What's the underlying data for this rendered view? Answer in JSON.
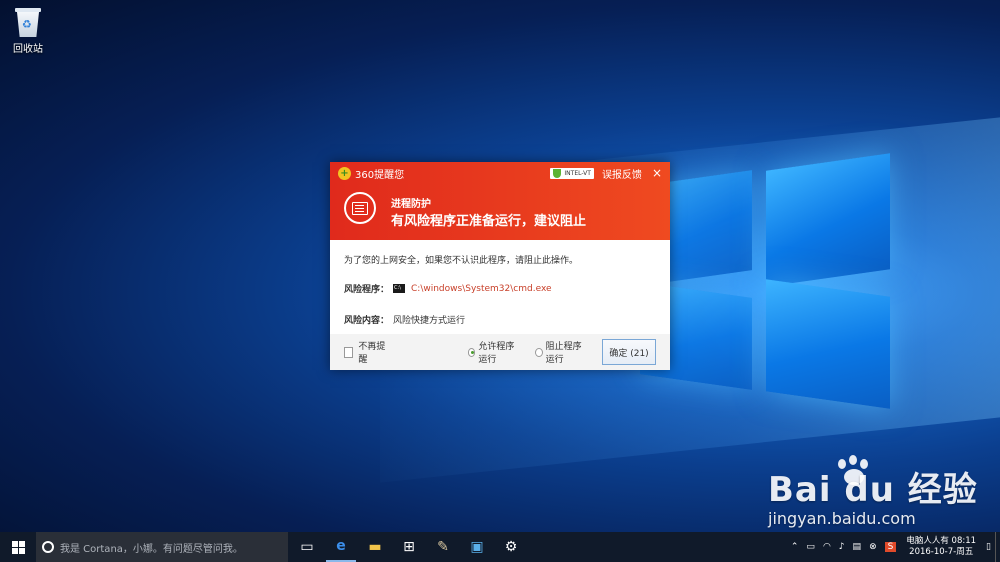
{
  "desktop": {
    "recycle_bin_label": "回收站"
  },
  "dialog": {
    "app_title": "360提醒您",
    "intel_badge": "INTEL-VT",
    "report_label": "误报反馈",
    "close_icon": "×",
    "subtitle": "进程防护",
    "headline": "有风险程序正准备运行，建议阻止",
    "message": "为了您的上网安全，如果您不认识此程序，请阻止此操作。",
    "risk_program_label": "风险程序：",
    "risk_program_path": "C:\\windows\\System32\\cmd.exe",
    "cmd_icon_text": "C:\\",
    "risk_content_label": "风险内容：",
    "risk_content_value": "风险快捷方式运行",
    "dont_remind_label": "不再提醒",
    "allow_label": "允许程序运行",
    "block_label": "阻止程序运行",
    "ok_button": "确定 (21)",
    "selected_option": "allow",
    "colors": {
      "header": "#e53a1e",
      "path": "#c8402a",
      "radio_dot": "#4a9b2f"
    }
  },
  "watermark": {
    "brand": "Bai du 经验",
    "url": "jingyan.baidu.com"
  },
  "taskbar": {
    "search_placeholder": "我是 Cortana，小娜。有问题尽管问我。",
    "apps": [
      "task-view-icon",
      "edge-icon",
      "file-explorer-icon",
      "store-icon",
      "paint-icon",
      "app-icon",
      "settings-icon"
    ],
    "tray_label": "电脑人人有",
    "time": "08:11",
    "date": "2016-10-7-周五",
    "ime_badge": "S"
  }
}
